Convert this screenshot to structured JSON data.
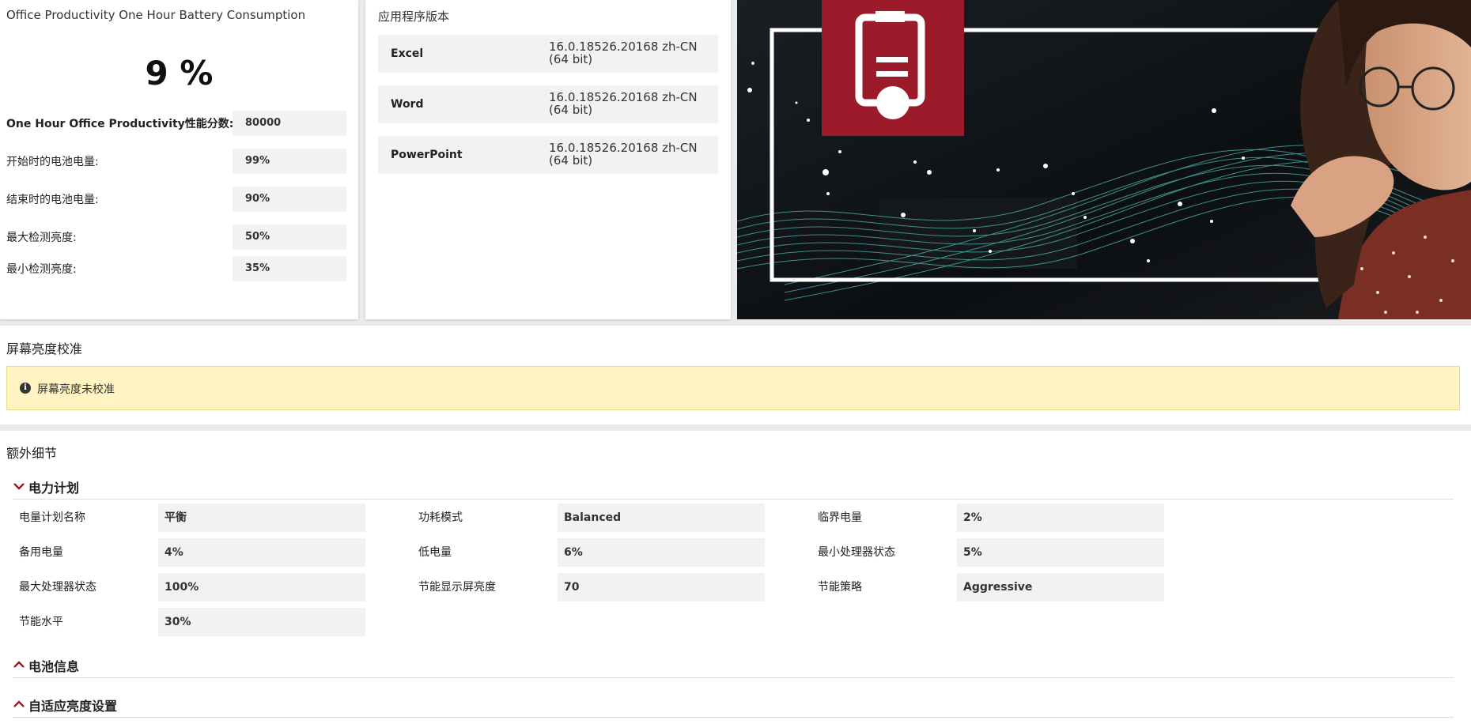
{
  "summary": {
    "title": "Office Productivity One Hour Battery Consumption",
    "big_value": "9 %",
    "metrics": [
      {
        "label": "One Hour Office Productivity性能分数:",
        "value": "80000"
      },
      {
        "label": "开始时的电池电量:",
        "value": "99%"
      },
      {
        "label": "结束时的电池电量:",
        "value": "90%"
      },
      {
        "label": "最大检测亮度:",
        "value": "50%"
      },
      {
        "label": "最小检测亮度:",
        "value": "35%"
      }
    ]
  },
  "apps": {
    "title": "应用程序版本",
    "rows": [
      {
        "name": "Excel",
        "version_line1": "16.0.18526.20168 zh-CN",
        "version_line2": "(64 bit)"
      },
      {
        "name": "Word",
        "version_line1": "16.0.18526.20168 zh-CN",
        "version_line2": "(64 bit)"
      },
      {
        "name": "PowerPoint",
        "version_line1": "16.0.18526.20168 zh-CN",
        "version_line2": "(64 bit)"
      }
    ]
  },
  "calibration": {
    "title": "屏幕亮度校准",
    "alert_icon": "info-icon",
    "alert_text": "屏幕亮度未校准"
  },
  "extra": {
    "title": "额外细节",
    "power_plan": {
      "title": "电力计划",
      "fields": [
        {
          "label": "电量计划名称",
          "value": "平衡"
        },
        {
          "label": "功耗模式",
          "value": "Balanced"
        },
        {
          "label": "临界电量",
          "value": "2%"
        },
        {
          "label": "备用电量",
          "value": "4%"
        },
        {
          "label": "低电量",
          "value": "6%"
        },
        {
          "label": "最小处理器状态",
          "value": "5%"
        },
        {
          "label": "最大处理器状态",
          "value": "100%"
        },
        {
          "label": "节能显示屏亮度",
          "value": "70"
        },
        {
          "label": "节能策略",
          "value": "Aggressive"
        },
        {
          "label": "节能水平",
          "value": "30%"
        }
      ]
    },
    "battery_info": {
      "title": "电池信息"
    },
    "adaptive_brightness": {
      "title": "自适应亮度设置"
    }
  },
  "colors": {
    "accent": "#9b1b2a",
    "alert_bg": "#fff4c2",
    "field_bg": "#f2f2f2",
    "wave": "#4fb8b0"
  }
}
